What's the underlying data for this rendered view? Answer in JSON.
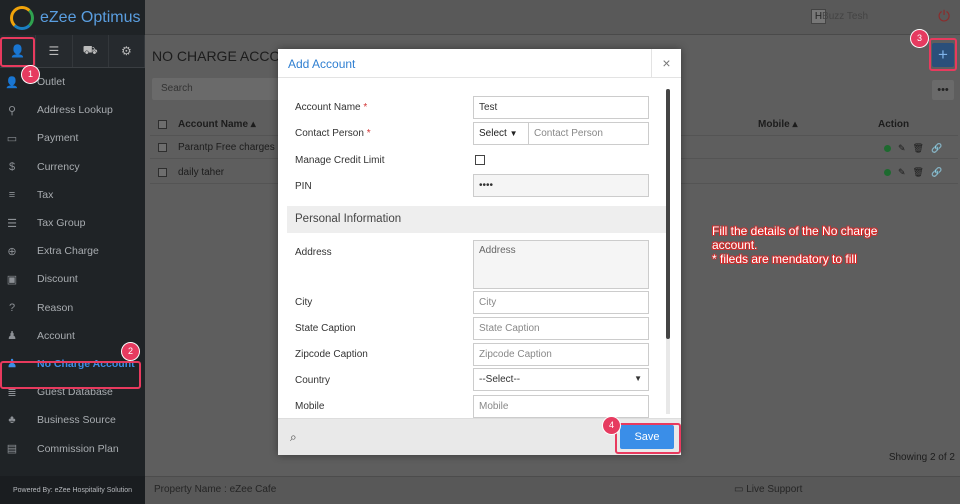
{
  "app": {
    "brand": "eZee Optimus"
  },
  "topbar": {
    "hotel_badge": "H",
    "user_name": "Buzz Tesh"
  },
  "sidebar": {
    "top_icons": [
      "user-icon",
      "list-icon",
      "cart-icon",
      "gear-icon"
    ],
    "items": [
      {
        "label": "Outlet",
        "icon": "person-icon",
        "glyph": "👤"
      },
      {
        "label": "Address Lookup",
        "icon": "pin-icon",
        "glyph": "⚲"
      },
      {
        "label": "Payment",
        "icon": "card-icon",
        "glyph": "▭"
      },
      {
        "label": "Currency",
        "icon": "dollar-icon",
        "glyph": "$"
      },
      {
        "label": "Tax",
        "icon": "lines-icon",
        "glyph": "≡"
      },
      {
        "label": "Tax Group",
        "icon": "list-icon",
        "glyph": "☰"
      },
      {
        "label": "Extra Charge",
        "icon": "plus-circle-icon",
        "glyph": "⊕"
      },
      {
        "label": "Discount",
        "icon": "gift-icon",
        "glyph": "▣"
      },
      {
        "label": "Reason",
        "icon": "question-icon",
        "glyph": "?"
      },
      {
        "label": "Account",
        "icon": "user-lock-icon",
        "glyph": "♟"
      },
      {
        "label": "No Charge Account",
        "icon": "user-icon",
        "glyph": "♟",
        "active": true
      },
      {
        "label": "Guest Database",
        "icon": "database-icon",
        "glyph": "≣"
      },
      {
        "label": "Business Source",
        "icon": "group-icon",
        "glyph": "♣"
      },
      {
        "label": "Commission Plan",
        "icon": "money-icon",
        "glyph": "▤"
      }
    ],
    "powered_by": "Powered By: eZee Hospitality Solution"
  },
  "main": {
    "page_title": "NO CHARGE ACCOU",
    "search_placeholder": "Search",
    "columns": {
      "name": "Account Name ▴",
      "mobile": "Mobile ▴",
      "action": "Action"
    },
    "rows": [
      {
        "name": "Parantp Free charges :)"
      },
      {
        "name": "daily taher"
      }
    ],
    "add_symbol": "+",
    "more_symbol": "•••",
    "showing": "Showing 2 of 2"
  },
  "footer": {
    "property": "Property Name : eZee Cafe",
    "live_support": "Live Support"
  },
  "modal": {
    "title": "Add Account",
    "close": "×",
    "fields": {
      "account_name": {
        "label": "Account Name",
        "required": "*",
        "value": "Test"
      },
      "contact_person": {
        "label": "Contact Person",
        "required": "*",
        "select": "Select",
        "placeholder": "Contact Person"
      },
      "manage_credit": {
        "label": "Manage Credit Limit"
      },
      "pin": {
        "label": "PIN",
        "value": "••••"
      },
      "section": "Personal Information",
      "address": {
        "label": "Address",
        "placeholder": "Address"
      },
      "city": {
        "label": "City",
        "placeholder": "City"
      },
      "state": {
        "label": "State Caption",
        "placeholder": "State Caption"
      },
      "zipcode": {
        "label": "Zipcode Caption",
        "placeholder": "Zipcode Caption"
      },
      "country": {
        "label": "Country",
        "value": "--Select--"
      },
      "mobile": {
        "label": "Mobile",
        "placeholder": "Mobile"
      }
    },
    "save": "Save"
  },
  "annotations": {
    "steps": [
      "1",
      "2",
      "3",
      "4"
    ],
    "note_line1": "Fill the details of the No charge account.",
    "note_line2": "* fileds are mendatory to fill",
    "color": "#e83a5e"
  }
}
